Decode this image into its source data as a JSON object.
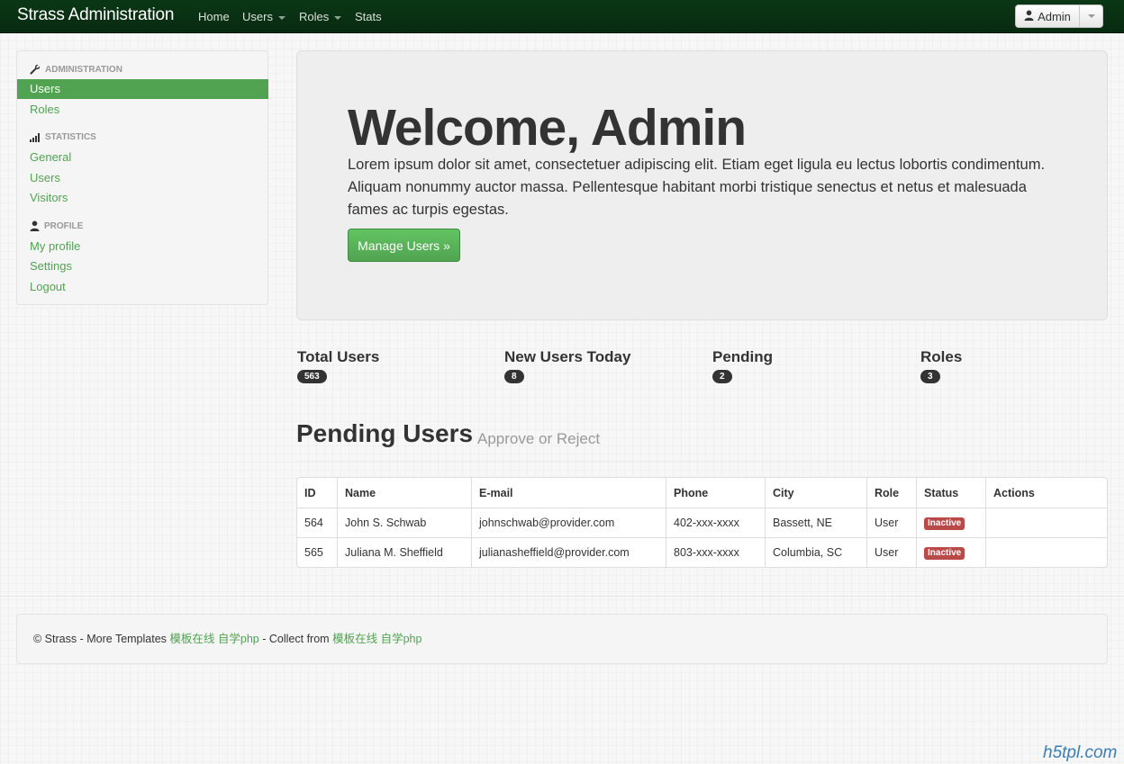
{
  "navbar": {
    "brand": "Strass Administration",
    "links": [
      "Home",
      "Users",
      "Roles",
      "Stats"
    ],
    "admin_label": "Admin"
  },
  "sidebar": {
    "sections": [
      {
        "header": "ADMINISTRATION",
        "icon": "wrench-icon",
        "items": [
          "Users",
          "Roles"
        ]
      },
      {
        "header": "STATISTICS",
        "icon": "signal-icon",
        "items": [
          "General",
          "Users",
          "Visitors"
        ]
      },
      {
        "header": "PROFILE",
        "icon": "user-icon",
        "items": [
          "My profile",
          "Settings",
          "Logout"
        ]
      }
    ],
    "active_item": "Users"
  },
  "hero": {
    "title": "Welcome, Admin",
    "text": "Lorem ipsum dolor sit amet, consectetuer adipiscing elit. Etiam eget ligula eu lectus lobortis condimentum. Aliquam nonummy auctor massa. Pellentesque habitant morbi tristique senectus et netus et malesuada fames ac turpis egestas.",
    "button": "Manage Users »"
  },
  "stats": [
    {
      "label": "Total Users",
      "value": "563"
    },
    {
      "label": "New Users Today",
      "value": "8"
    },
    {
      "label": "Pending",
      "value": "2"
    },
    {
      "label": "Roles",
      "value": "3"
    }
  ],
  "pending": {
    "title": "Pending Users",
    "subtitle": "Approve or Reject",
    "columns": [
      "ID",
      "Name",
      "E-mail",
      "Phone",
      "City",
      "Role",
      "Status",
      "Actions"
    ],
    "rows": [
      {
        "id": "564",
        "name": "John S. Schwab",
        "email": "johnschwab@provider.com",
        "phone": "402-xxx-xxxx",
        "city": "Bassett, NE",
        "role": "User",
        "status": "Inactive",
        "actions": ""
      },
      {
        "id": "565",
        "name": "Juliana M. Sheffield",
        "email": "julianasheffield@provider.com",
        "phone": "803-xxx-xxxx",
        "city": "Columbia, SC",
        "role": "User",
        "status": "Inactive",
        "actions": ""
      }
    ]
  },
  "footer": {
    "copyright": "© Strass - More Templates",
    "link1": "模板在线",
    "link2": "自学php",
    "collect": "- Collect from",
    "link3": "模板在线",
    "link4": "自学php"
  },
  "watermark": "h5tpl.com",
  "colors": {
    "navbar": "#0b3716",
    "accent_green": "#51a351",
    "badge_dark": "#333333",
    "status_inactive": "#b94a48"
  }
}
